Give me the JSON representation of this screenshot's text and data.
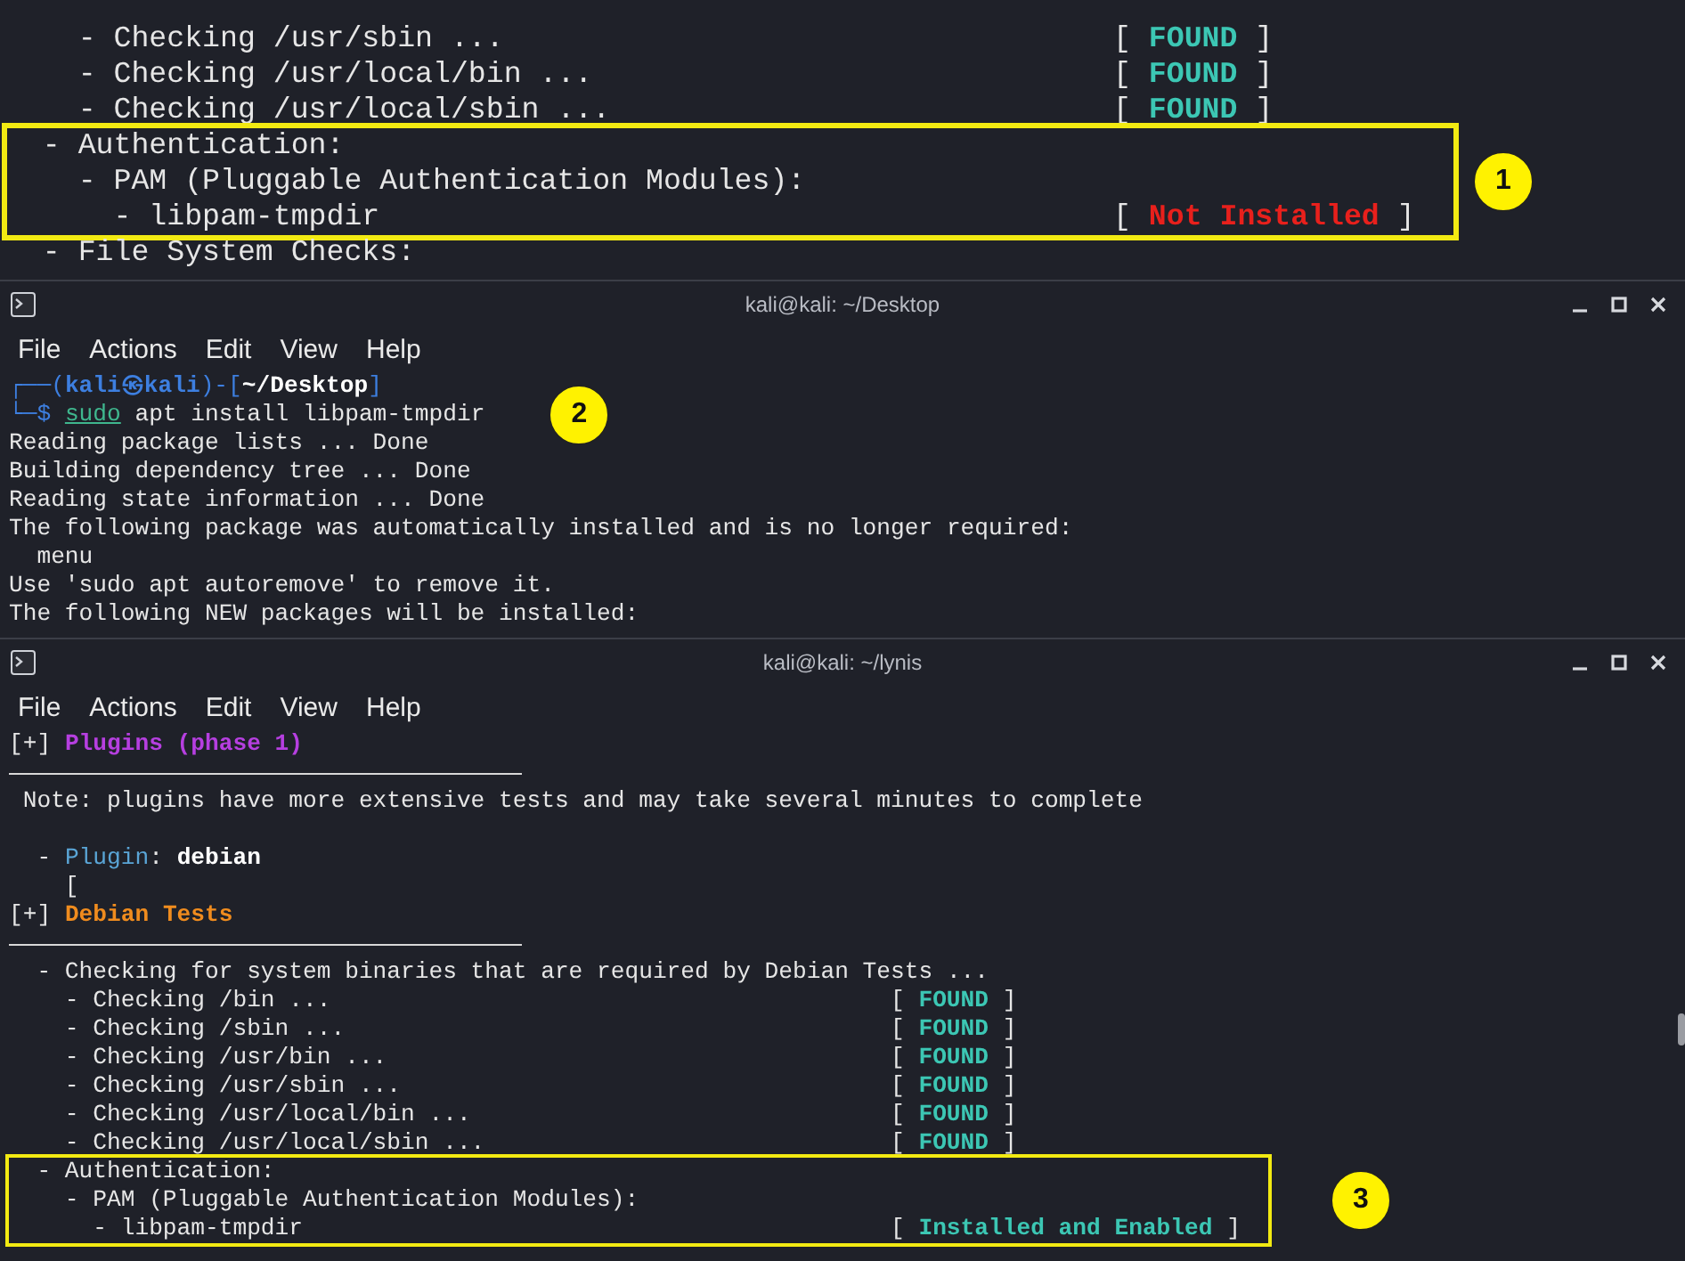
{
  "windows": [
    {
      "body": [
        {
          "kind": "line",
          "parts": [
            {
              "text": "    - Checking /usr/sbin ...",
              "kind": "plain"
            }
          ],
          "status": [
            {
              "text": "[ ",
              "kind": "plain"
            },
            {
              "text": "FOUND",
              "kind": "found"
            },
            {
              "text": " ]",
              "kind": "plain"
            }
          ]
        },
        {
          "kind": "line",
          "parts": [
            {
              "text": "    - Checking /usr/local/bin ...",
              "kind": "plain"
            }
          ],
          "status": [
            {
              "text": "[ ",
              "kind": "plain"
            },
            {
              "text": "FOUND",
              "kind": "found"
            },
            {
              "text": " ]",
              "kind": "plain"
            }
          ]
        },
        {
          "kind": "line",
          "parts": [
            {
              "text": "    - Checking /usr/local/sbin ...",
              "kind": "plain"
            }
          ],
          "status": [
            {
              "text": "[ ",
              "kind": "plain"
            },
            {
              "text": "FOUND",
              "kind": "found"
            },
            {
              "text": " ]",
              "kind": "plain"
            }
          ]
        },
        {
          "kind": "highlight",
          "badge": "1",
          "lines": [
            {
              "kind": "line",
              "parts": [
                {
                  "text": "  - Authentication:",
                  "kind": "plain"
                }
              ]
            },
            {
              "kind": "line",
              "parts": [
                {
                  "text": "    - PAM (Pluggable Authentication Modules):",
                  "kind": "plain"
                }
              ]
            },
            {
              "kind": "line",
              "parts": [
                {
                  "text": "      - libpam-tmpdir",
                  "kind": "plain"
                }
              ],
              "status": [
                {
                  "text": "[ ",
                  "kind": "plain"
                },
                {
                  "text": "Not Installed",
                  "kind": "error"
                },
                {
                  "text": " ]",
                  "kind": "plain"
                }
              ]
            }
          ]
        },
        {
          "kind": "line",
          "parts": [
            {
              "text": "  - File System Checks:",
              "kind": "plain"
            }
          ]
        }
      ]
    },
    {
      "title": "kali@kali: ~/Desktop",
      "menu": [
        "File",
        "Actions",
        "Edit",
        "View",
        "Help"
      ],
      "body": [
        {
          "kind": "line",
          "parts": [
            {
              "text": "┌──(",
              "kind": "prompt"
            },
            {
              "text": "kali㉿kali",
              "kind": "prompt-user"
            },
            {
              "text": ")-[",
              "kind": "prompt"
            },
            {
              "text": "~/Desktop",
              "kind": "path"
            },
            {
              "text": "]",
              "kind": "prompt"
            }
          ]
        },
        {
          "kind": "line",
          "badge": "2",
          "parts": [
            {
              "text": "└─$ ",
              "kind": "prompt"
            },
            {
              "text": "sudo",
              "kind": "sudo"
            },
            {
              "text": " apt install libpam-tmpdir",
              "kind": "plain"
            }
          ]
        },
        {
          "kind": "line",
          "parts": [
            {
              "text": "Reading package lists ... Done",
              "kind": "plain"
            }
          ]
        },
        {
          "kind": "line",
          "parts": [
            {
              "text": "Building dependency tree ... Done",
              "kind": "plain"
            }
          ]
        },
        {
          "kind": "line",
          "parts": [
            {
              "text": "Reading state information ... Done",
              "kind": "plain"
            }
          ]
        },
        {
          "kind": "line",
          "parts": [
            {
              "text": "The following package was automatically installed and is no longer required:",
              "kind": "plain"
            }
          ]
        },
        {
          "kind": "line",
          "parts": [
            {
              "text": "  menu",
              "kind": "plain"
            }
          ]
        },
        {
          "kind": "line",
          "parts": [
            {
              "text": "Use 'sudo apt autoremove' to remove it.",
              "kind": "plain"
            }
          ]
        },
        {
          "kind": "line",
          "parts": [
            {
              "text": "The following NEW packages will be installed:",
              "kind": "plain"
            }
          ]
        }
      ]
    },
    {
      "title": "kali@kali: ~/lynis",
      "menu": [
        "File",
        "Actions",
        "Edit",
        "View",
        "Help"
      ],
      "body": [
        {
          "kind": "line",
          "parts": [
            {
              "text": "[+] ",
              "kind": "plain"
            },
            {
              "text": "Plugins (phase 1)",
              "kind": "purple"
            }
          ]
        },
        {
          "kind": "rule"
        },
        {
          "kind": "line",
          "parts": [
            {
              "text": " Note: plugins have more extensive tests and may take several minutes to complete",
              "kind": "plain"
            }
          ]
        },
        {
          "kind": "blank"
        },
        {
          "kind": "line",
          "parts": [
            {
              "text": "  - ",
              "kind": "plain"
            },
            {
              "text": "Plugin",
              "kind": "blue"
            },
            {
              "text": ": ",
              "kind": "plain"
            },
            {
              "text": "debian",
              "kind": "bold"
            }
          ]
        },
        {
          "kind": "line",
          "parts": [
            {
              "text": "    [",
              "kind": "plain"
            }
          ]
        },
        {
          "kind": "line",
          "parts": [
            {
              "text": "[+] ",
              "kind": "plain"
            },
            {
              "text": "Debian Tests",
              "kind": "orange"
            }
          ]
        },
        {
          "kind": "rule"
        },
        {
          "kind": "line",
          "parts": [
            {
              "text": "  - Checking for system binaries that are required by Debian Tests ...",
              "kind": "plain"
            }
          ]
        },
        {
          "kind": "line",
          "parts": [
            {
              "text": "    - Checking /bin ...",
              "kind": "plain"
            }
          ],
          "status": [
            {
              "text": "[ ",
              "kind": "plain"
            },
            {
              "text": "FOUND",
              "kind": "found"
            },
            {
              "text": " ]",
              "kind": "plain"
            }
          ]
        },
        {
          "kind": "line",
          "parts": [
            {
              "text": "    - Checking /sbin ...",
              "kind": "plain"
            }
          ],
          "status": [
            {
              "text": "[ ",
              "kind": "plain"
            },
            {
              "text": "FOUND",
              "kind": "found"
            },
            {
              "text": " ]",
              "kind": "plain"
            }
          ]
        },
        {
          "kind": "line",
          "parts": [
            {
              "text": "    - Checking /usr/bin ...",
              "kind": "plain"
            }
          ],
          "status": [
            {
              "text": "[ ",
              "kind": "plain"
            },
            {
              "text": "FOUND",
              "kind": "found"
            },
            {
              "text": " ]",
              "kind": "plain"
            }
          ]
        },
        {
          "kind": "line",
          "parts": [
            {
              "text": "    - Checking /usr/sbin ...",
              "kind": "plain"
            }
          ],
          "status": [
            {
              "text": "[ ",
              "kind": "plain"
            },
            {
              "text": "FOUND",
              "kind": "found"
            },
            {
              "text": " ]",
              "kind": "plain"
            }
          ]
        },
        {
          "kind": "line",
          "parts": [
            {
              "text": "    - Checking /usr/local/bin ...",
              "kind": "plain"
            }
          ],
          "status": [
            {
              "text": "[ ",
              "kind": "plain"
            },
            {
              "text": "FOUND",
              "kind": "found"
            },
            {
              "text": " ]",
              "kind": "plain"
            }
          ]
        },
        {
          "kind": "line",
          "parts": [
            {
              "text": "    - Checking /usr/local/sbin ...",
              "kind": "plain"
            }
          ],
          "status": [
            {
              "text": "[ ",
              "kind": "plain"
            },
            {
              "text": "FOUND",
              "kind": "found"
            },
            {
              "text": " ]",
              "kind": "plain"
            }
          ]
        },
        {
          "kind": "highlight",
          "badge": "3",
          "lines": [
            {
              "kind": "line",
              "parts": [
                {
                  "text": "  - Authentication:",
                  "kind": "plain"
                }
              ]
            },
            {
              "kind": "line",
              "parts": [
                {
                  "text": "    - PAM (Pluggable Authentication Modules):",
                  "kind": "plain"
                }
              ]
            },
            {
              "kind": "line",
              "parts": [
                {
                  "text": "      - libpam-tmpdir",
                  "kind": "plain"
                }
              ],
              "status": [
                {
                  "text": "[ ",
                  "kind": "plain"
                },
                {
                  "text": "Installed and Enabled",
                  "kind": "found"
                },
                {
                  "text": " ]",
                  "kind": "plain"
                }
              ]
            }
          ]
        }
      ]
    }
  ]
}
